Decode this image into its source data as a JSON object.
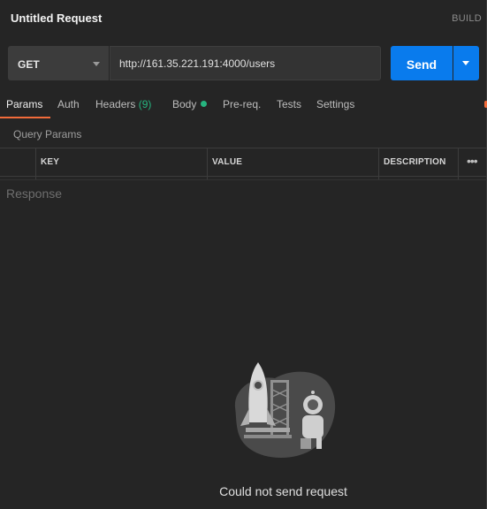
{
  "header": {
    "title": "Untitled Request",
    "mode_label": "BUILD"
  },
  "request": {
    "method": "GET",
    "url": "http://161.35.221.191:4000/users",
    "send_label": "Send"
  },
  "tabs": [
    {
      "label": "Params",
      "active": true
    },
    {
      "label": "Auth"
    },
    {
      "label": "Headers",
      "badge": "(9)"
    },
    {
      "label": "Body",
      "indicator": "green-dot"
    },
    {
      "label": "Pre-req."
    },
    {
      "label": "Tests"
    },
    {
      "label": "Settings"
    }
  ],
  "query_params": {
    "title": "Query Params",
    "columns": [
      "KEY",
      "VALUE",
      "DESCRIPTION"
    ],
    "more_label": "•••"
  },
  "response": {
    "title": "Response",
    "error_message": "Could not send request",
    "illustration": "rocket-astronaut-illustration"
  },
  "colors": {
    "accent": "#f26b3a",
    "send_button": "#097bed",
    "body_dot": "#26b47f",
    "background": "#252525"
  }
}
